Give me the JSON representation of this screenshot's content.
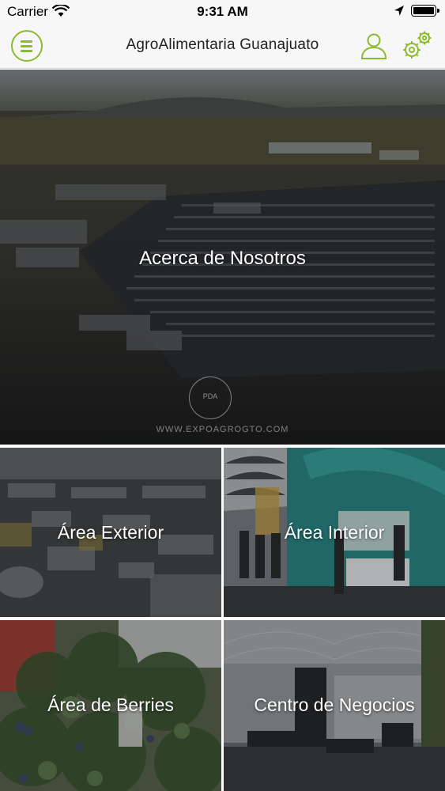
{
  "status_bar": {
    "carrier": "Carrier",
    "time": "9:31 AM"
  },
  "nav": {
    "title": "AgroAlimentaria Guanajuato",
    "menu_icon": "hamburger-menu-icon",
    "user_icon": "user-profile-icon",
    "settings_icon": "gears-icon",
    "accent_color": "#8dba2f"
  },
  "hero": {
    "label": "Acerca de Nosotros",
    "watermark": "WWW.EXPOAGROGTO.COM",
    "seal_text": "PDA"
  },
  "tiles": [
    {
      "label": "Área Exterior"
    },
    {
      "label": "Área Interior"
    },
    {
      "label": "Área de Berries"
    },
    {
      "label": "Centro de Negocios"
    }
  ]
}
